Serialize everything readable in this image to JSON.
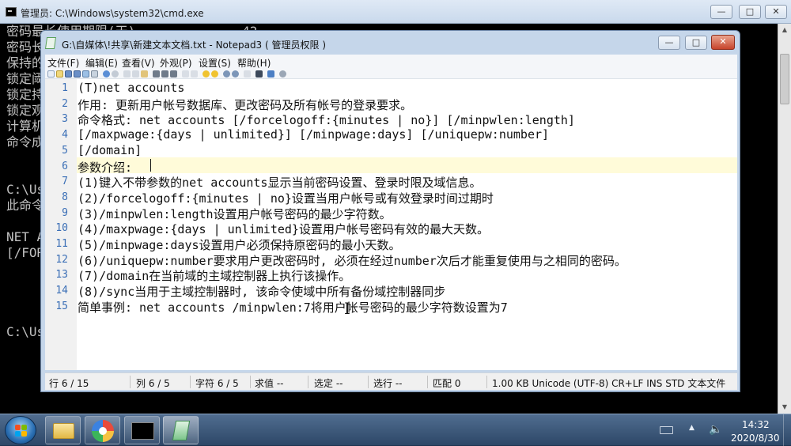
{
  "cmd": {
    "title": "管理员: C:\\Windows\\system32\\cmd.exe",
    "lines": [
      "密码最长使用期限(天)              42",
      "密码长度最小值",
      "保持的密码历史记录长度",
      "锁定阈值",
      "锁定持续时间(分)",
      "锁定观测窗口(分)",
      "计算机角色",
      "命令成功完成。",
      "",
      "",
      "C:\\Users",
      "此命令的语法是:",
      "",
      "NET ACCOUNTS",
      "[/FORCELOGOFF",
      "",
      "",
      "",
      "",
      "C:\\Users"
    ]
  },
  "notepad": {
    "title": "G:\\自媒体\\!共享\\新建文本文档.txt - Notepad3  ( 管理员权限 )",
    "menu": [
      "文件(F)",
      "编辑(E)",
      "查看(V)",
      "外观(P)",
      "设置(S)",
      "帮助(H)"
    ],
    "lines": [
      "(T)net accounts",
      "作用: 更新用户帐号数据库、更改密码及所有帐号的登录要求。",
      "命令格式: net accounts [/forcelogoff:{minutes | no}] [/minpwlen:length]",
      "[/maxpwage:{days | unlimited}] [/minpwage:days] [/uniquepw:number]",
      "[/domain]",
      "参数介绍:",
      "(1)键入不带参数的net accounts显示当前密码设置、登录时限及域信息。",
      "(2)/forcelogoff:{minutes | no}设置当用户帐号或有效登录时间过期时",
      "(3)/minpwlen:length设置用户帐号密码的最少字符数。",
      "(4)/maxpwage:{days | unlimited}设置用户帐号密码有效的最大天数。",
      "(5)/minpwage:days设置用户必须保持原密码的最小天数。",
      "(6)/uniquepw:number要求用户更改密码时, 必须在经过number次后才能重复使用与之相同的密码。",
      "(7)/domain在当前域的主域控制器上执行该操作。",
      "(8)/sync当用于主域控制器时, 该命令使域中所有备份域控制器同步",
      "简单事例: net accounts /minpwlen:7将用户帐号密码的最少字符数设置为7"
    ],
    "line_numbers": [
      "1",
      "2",
      "3",
      "4",
      "5",
      "6",
      "7",
      "8",
      "9",
      "10",
      "11",
      "12",
      "13",
      "14",
      "15"
    ],
    "status": {
      "line": "行 6 / 15",
      "col": "列 6 / 5",
      "char": "字符 6 / 5",
      "value": "求值 --",
      "sel": "选定 --",
      "sellines": "选行 --",
      "match": "匹配 0",
      "info": "1.00 KB   Unicode (UTF-8)   CR+LF   INS   STD   文本文件"
    }
  },
  "taskbar": {
    "clock_time": "14:32",
    "clock_date": "2020/8/30"
  },
  "colors": {
    "line_number": "#3b6fb6",
    "current_line": "#fffbd9",
    "close_button": "#c7442b"
  }
}
